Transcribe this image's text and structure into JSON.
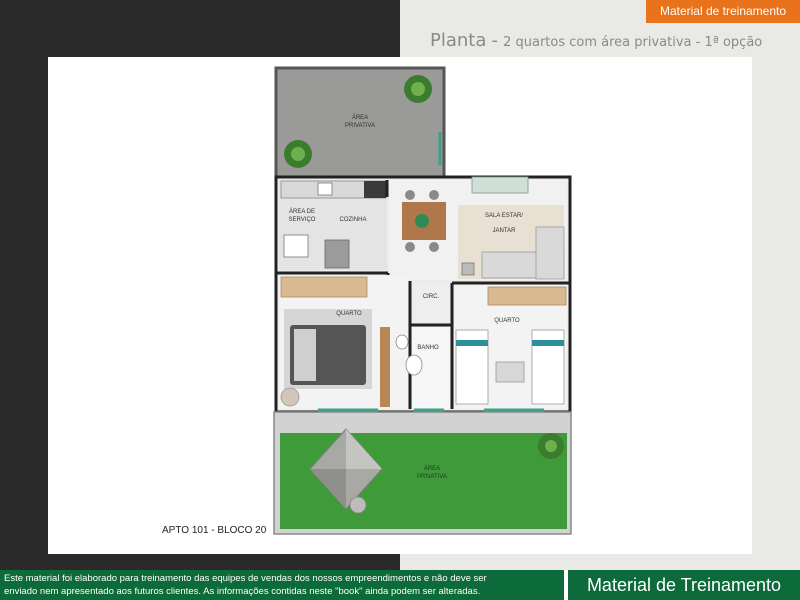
{
  "badge": "Material de treinamento",
  "title": {
    "main": "Planta",
    "sep": "-",
    "sub": "2 quartos com área privativa - 1ª opção"
  },
  "plan": {
    "rooms": {
      "area_privativa_top": [
        "ÁREA",
        "PRIVATIVA"
      ],
      "area_servico": [
        "ÁREA DE",
        "SERVIÇO"
      ],
      "cozinha": "COZINHA",
      "sala": [
        "SALA ESTAR/",
        "JANTAR"
      ],
      "circ": "CIRC.",
      "quarto_1": "QUARTO",
      "quarto_2": "QUARTO",
      "banho": "BANHO",
      "area_privativa_bottom": [
        "ÁREA",
        "PRIVATIVA"
      ]
    },
    "apto_label": "APTO 101 - BLOCO 20"
  },
  "footer": {
    "notice_line1": "Este material foi elaborado para treinamento das equipes de vendas dos nossos empreendimentos e não deve ser",
    "notice_line2": "enviado nem apresentado aos futuros clientes. As informações contidas neste \"book\" ainda podem ser alteradas.",
    "brand_label": "Material de Treinamento"
  }
}
